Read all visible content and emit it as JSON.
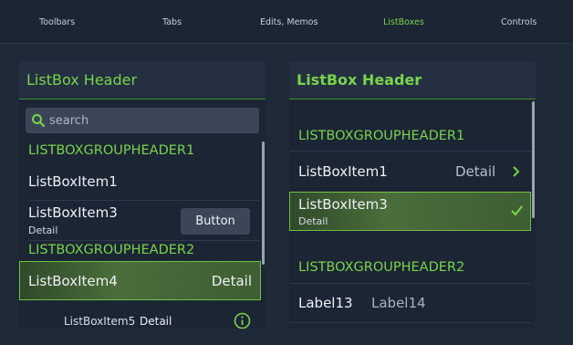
{
  "tabs": [
    {
      "label": "Toolbars"
    },
    {
      "label": "Tabs"
    },
    {
      "label": "Edits, Memos"
    },
    {
      "label": "ListBoxes"
    },
    {
      "label": "Controls"
    }
  ],
  "left": {
    "header": "ListBox Header",
    "search": {
      "placeholder": "search"
    },
    "group1": "LISTBOXGROUPHEADER1",
    "item1": {
      "title": "ListBoxItem1"
    },
    "item3": {
      "title": "ListBoxItem3",
      "detail": "Detail",
      "button": "Button"
    },
    "group2": "LISTBOXGROUPHEADER2",
    "item4": {
      "title": "ListBoxItem4",
      "detail": "Detail"
    },
    "item5": {
      "title": "ListBoxItem5",
      "detail": "Detail"
    }
  },
  "right": {
    "header": "ListBox Header",
    "group1": "LISTBOXGROUPHEADER1",
    "item1": {
      "title": "ListBoxItem1",
      "detail": "Detail"
    },
    "item3": {
      "title": "ListBoxItem3",
      "detail": "Detail"
    },
    "group2": "LISTBOXGROUPHEADER2",
    "labels": {
      "label13": "Label13",
      "label14": "Label14"
    }
  },
  "icons": {
    "search": "search-icon",
    "chevron": "chevron-right-icon",
    "check": "check-icon",
    "info": "info-icon"
  },
  "colors": {
    "accent": "#7ad34a",
    "background": "#1f2a38",
    "panel": "#1b2534"
  }
}
